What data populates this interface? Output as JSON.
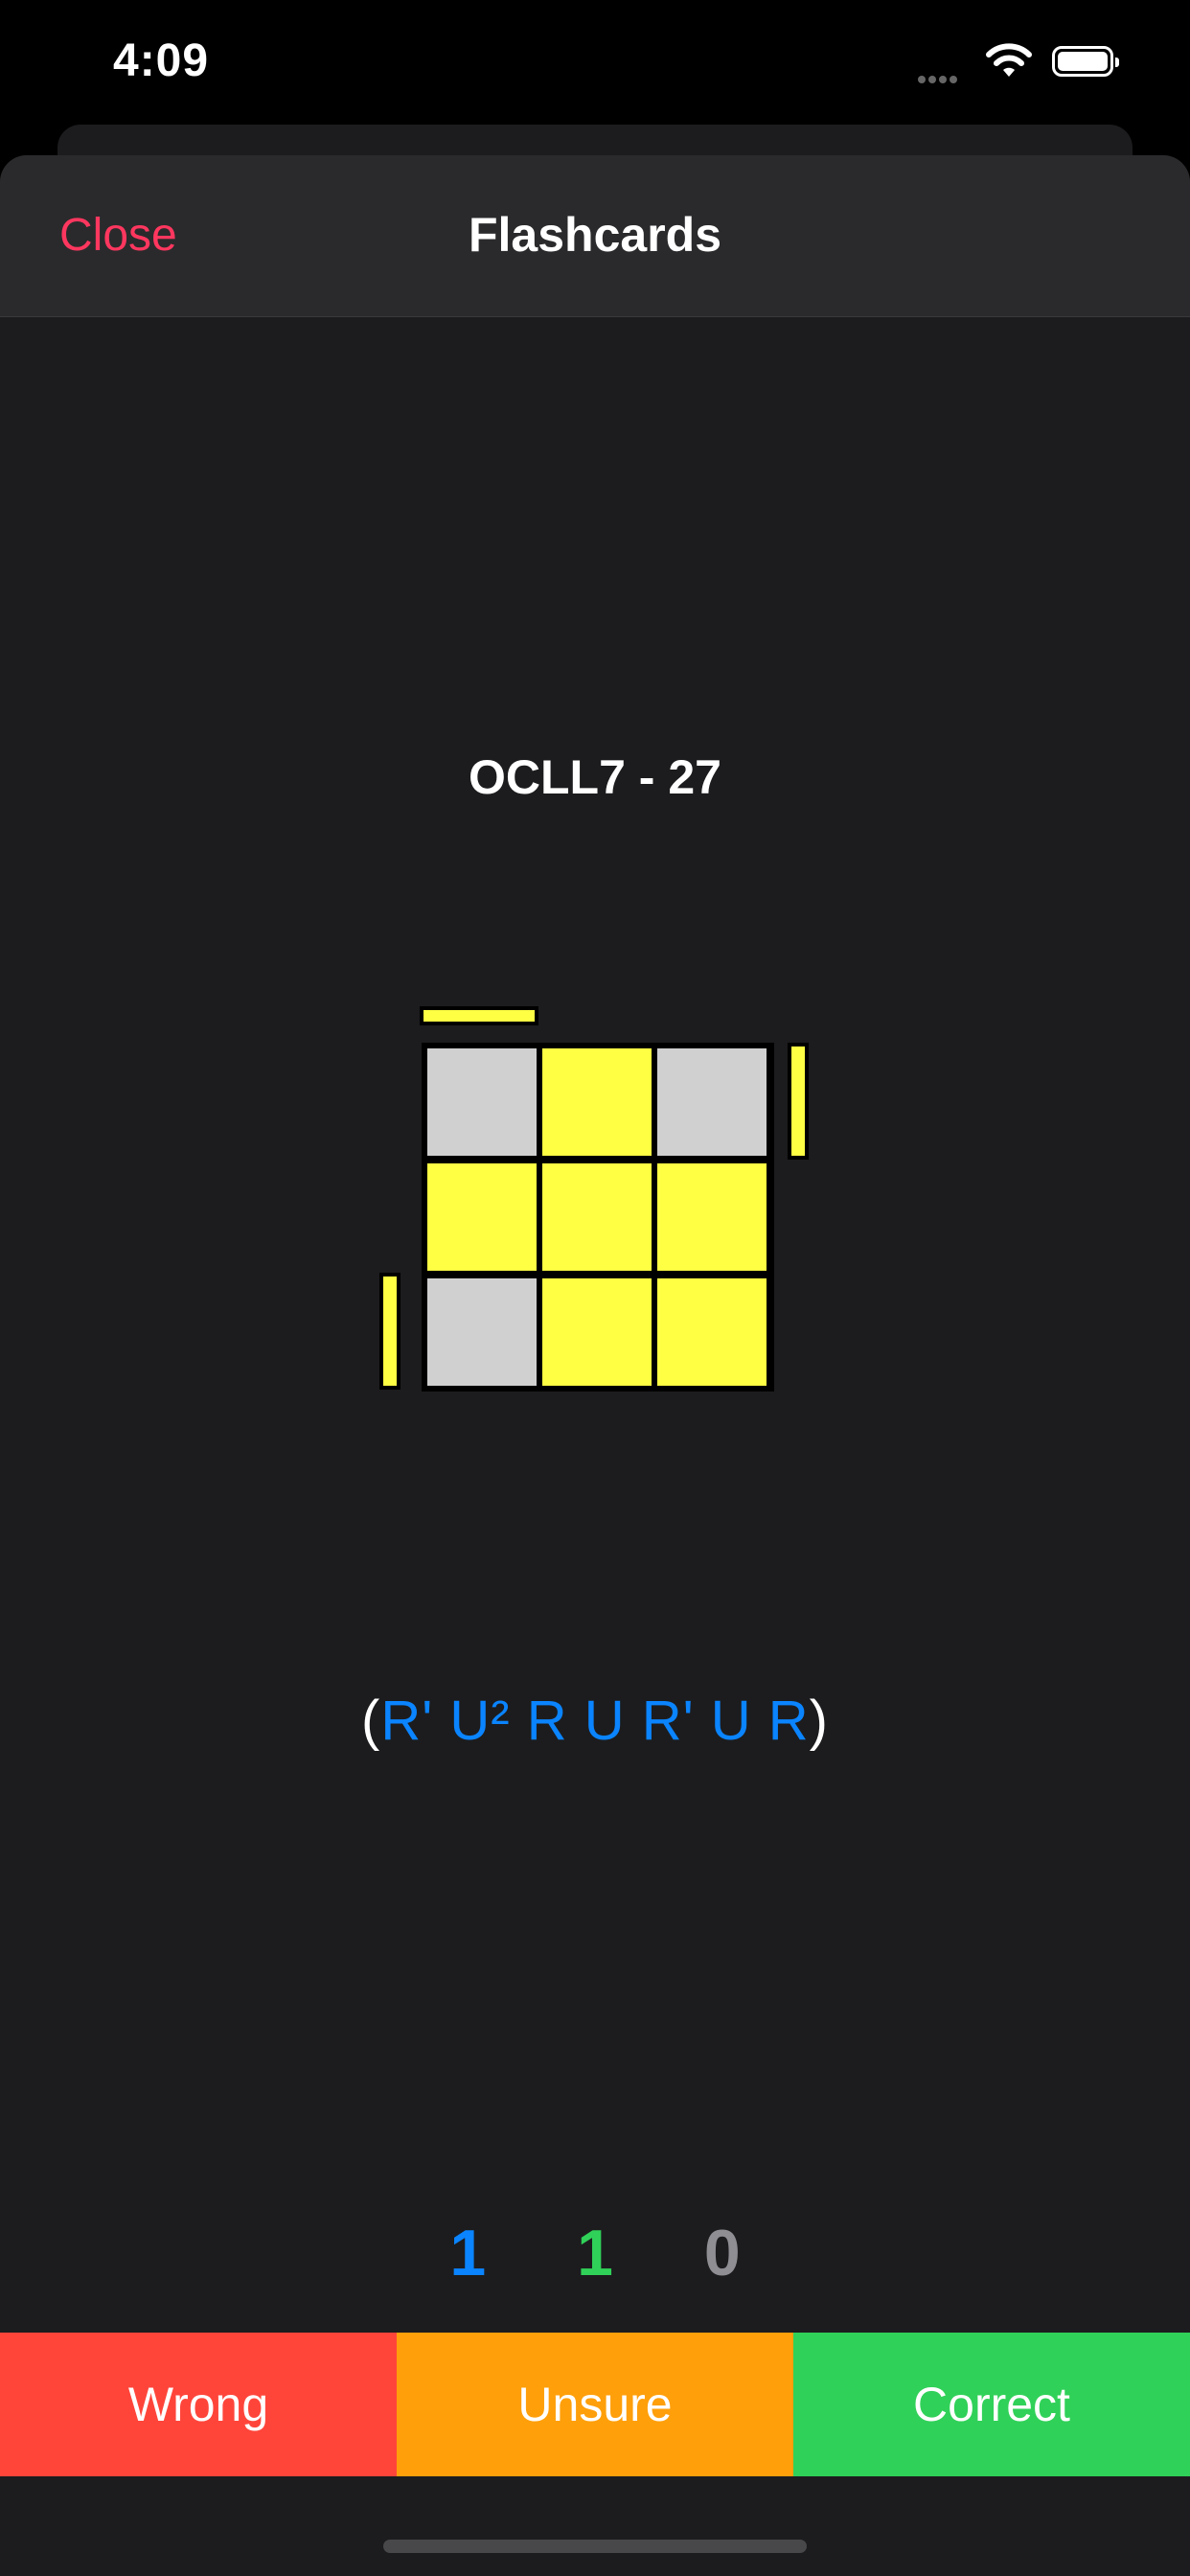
{
  "status_bar": {
    "time": "4:09",
    "icons": [
      "cellular-icon",
      "wifi-icon",
      "battery-icon"
    ]
  },
  "nav": {
    "close_label": "Close",
    "title": "Flashcards"
  },
  "card": {
    "case_name": "OCLL7 - 27",
    "algorithm": {
      "open": "(",
      "moves": "R' U² R U R' U R",
      "close": ")"
    },
    "diagram": {
      "top_face": [
        [
          "gray",
          "yellow",
          "gray"
        ],
        [
          "yellow",
          "yellow",
          "yellow"
        ],
        [
          "gray",
          "yellow",
          "yellow"
        ]
      ],
      "side_stickers": [
        "top-left-yellow",
        "right-top-yellow",
        "left-bottom-yellow"
      ],
      "colors": {
        "yellow": "#ffff44",
        "gray": "#d0d0d0",
        "outline": "#000000"
      }
    }
  },
  "counters": {
    "wrong": "1",
    "unsure": "1",
    "correct": "0"
  },
  "buttons": {
    "wrong": "Wrong",
    "unsure": "Unsure",
    "correct": "Correct"
  },
  "colors": {
    "accent_red": "#ff375f",
    "wrong": "#ff453a",
    "unsure": "#ff9f0a",
    "correct": "#30d158",
    "blue": "#0a84ff",
    "background": "#1c1c1e"
  }
}
